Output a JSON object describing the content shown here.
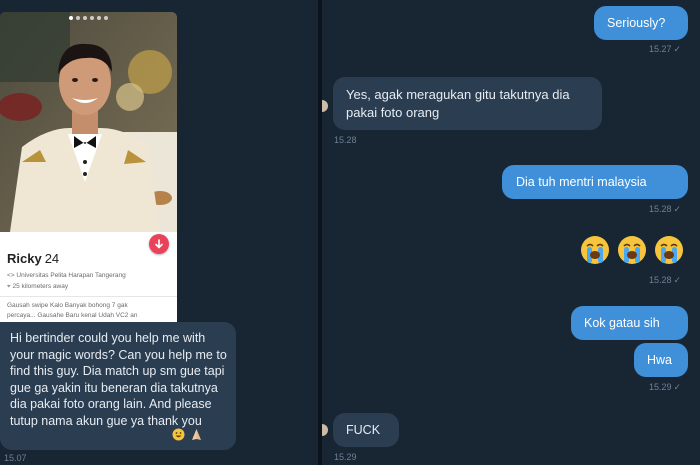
{
  "profile": {
    "name": "Ricky",
    "age": "24",
    "school": "Universitas Pelita Harapan Tangerang",
    "distance": "25 kilometers away",
    "bio_line1": "Gausah swipe Kalo Banyak bohong 7 gak",
    "bio_line2": "percaya... Gausahe Baru kenal Udah VC2 an"
  },
  "left_chat": {
    "message": "Hi bertinder could you help me with your magic words? Can you help me to find this guy. Dia match up sm gue tapi gue ga yakin itu beneran dia takutnya dia pakai foto orang lain. And please tutup nama akun gue ya thank you",
    "time": "15.07"
  },
  "right_chat": {
    "messages": [
      {
        "text": "Seriously?",
        "time": "15.27",
        "direction": "outgoing"
      },
      {
        "text": "Yes, agak meragukan gitu takutnya dia pakai foto orang",
        "time": "15.28",
        "direction": "incoming"
      },
      {
        "text": "Dia tuh mentri malaysia",
        "time": "15.28",
        "direction": "outgoing"
      },
      {
        "text": "",
        "time": "15.28",
        "direction": "outgoing",
        "emoji": [
          "loudly-crying-face",
          "loudly-crying-face",
          "loudly-crying-face"
        ]
      },
      {
        "text": "Kok gatau sih",
        "time": "",
        "direction": "outgoing"
      },
      {
        "text": "Hwa",
        "time": "15.29",
        "direction": "outgoing"
      },
      {
        "text": "FUCK",
        "time": "15.29",
        "direction": "incoming"
      }
    ]
  },
  "colors": {
    "chat_background": "#182533",
    "incoming_bubble": "#2b3d51",
    "outgoing_bubble": "#3f8fd9",
    "timestamp": "#6d8195",
    "tinder_button": "#e8435a"
  }
}
